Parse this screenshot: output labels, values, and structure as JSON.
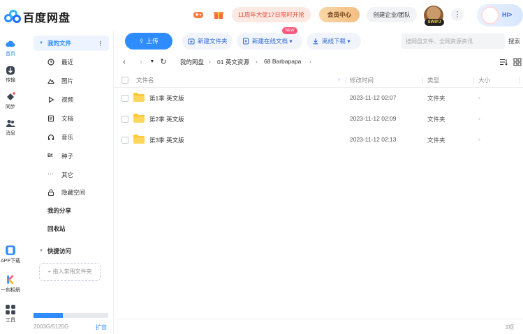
{
  "app": {
    "title": "百度网盘"
  },
  "header": {
    "promo": "11周年大促17日限时开抢",
    "vip_center": "会员中心",
    "business": "创建企业/团队",
    "avatar_badge": "SWIPJ",
    "more": "⋮",
    "assistant_label": "Hi>",
    "colors": {
      "brand": "#2f8cff",
      "promo_text": "#e64a3a",
      "vip_gold": "#f3bd83"
    }
  },
  "rail": {
    "items": [
      {
        "label": "首页",
        "icon": "cloud-home-icon"
      },
      {
        "label": "传输",
        "icon": "transfer-icon"
      },
      {
        "label": "同步",
        "icon": "sync-icon"
      },
      {
        "label": "消息",
        "icon": "message-icon"
      },
      {
        "label": "APP下载",
        "icon": "app-download-icon"
      },
      {
        "label": "一刻相册",
        "icon": "album-icon"
      },
      {
        "label": "工具",
        "icon": "tools-grid-icon"
      }
    ]
  },
  "sidebar": {
    "root": "我的文件",
    "items": [
      {
        "label": "最近",
        "icon": "clock-icon"
      },
      {
        "label": "图片",
        "icon": "image-icon"
      },
      {
        "label": "视频",
        "icon": "video-play-icon"
      },
      {
        "label": "文档",
        "icon": "document-icon"
      },
      {
        "label": "音乐",
        "icon": "headphones-icon"
      },
      {
        "label": "种子",
        "icon": "bt-icon"
      },
      {
        "label": "其它",
        "icon": "ellipsis-icon"
      },
      {
        "label": "隐藏空间",
        "icon": "lock-icon"
      }
    ],
    "my_share": "我的分享",
    "recycle": "回收站",
    "quick_access": "快捷访问",
    "drop_hint": "+ 拖入常用文件夹",
    "quota_text": "2003G/5125G",
    "quota_fraction": 0.39,
    "expand": "扩容"
  },
  "toolbar": {
    "upload": "上传",
    "new_folder": "新建文件夹",
    "new_online_doc": "新建在线文档",
    "new_tag": "NEW",
    "offline_download": "离线下载",
    "search_placeholder": "搜网盘文件、全网资源资讯",
    "search_label": "搜索"
  },
  "breadcrumb": [
    "我的网盘",
    "01 英文资源",
    "68 Barbapapa"
  ],
  "table": {
    "headers": {
      "name": "文件名",
      "time": "修改时间",
      "type": "类型",
      "size": "大小"
    },
    "rows": [
      {
        "name": "第1季 英文版",
        "time": "2023-11-12 02:07",
        "type": "文件夹",
        "size": "-"
      },
      {
        "name": "第2季 英文版",
        "time": "2023-11-12 02:09",
        "type": "文件夹",
        "size": "-"
      },
      {
        "name": "第3季 英文版",
        "time": "2023-11-12 02:13",
        "type": "文件夹",
        "size": "-"
      }
    ]
  },
  "footer": {
    "count": "3项"
  }
}
